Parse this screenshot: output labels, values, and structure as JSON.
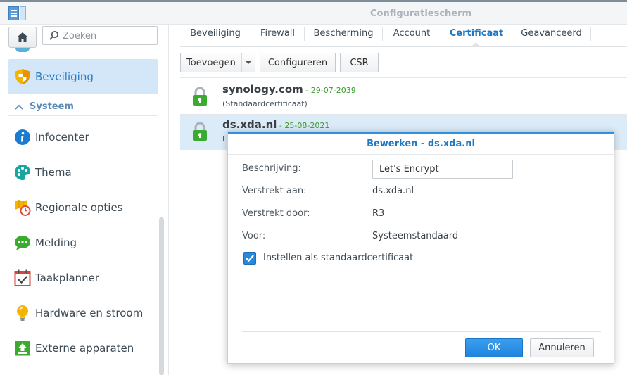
{
  "window": {
    "title": "Configuratiescherm",
    "app_icon": "control-panel-icon"
  },
  "sidebar": {
    "search": {
      "placeholder": "Zoeken",
      "value": ""
    },
    "home_icon": "home-icon",
    "active_item": {
      "label": "Beveiliging",
      "icon": "shield-icon"
    },
    "section": {
      "label": "Systeem",
      "collapse_icon": "chevron-up-icon"
    },
    "items": [
      {
        "label": "Infocenter",
        "icon": "info-icon"
      },
      {
        "label": "Thema",
        "icon": "palette-icon"
      },
      {
        "label": "Regionale opties",
        "icon": "map-clock-icon"
      },
      {
        "label": "Melding",
        "icon": "chat-bubble-icon"
      },
      {
        "label": "Taakplanner",
        "icon": "calendar-check-icon"
      },
      {
        "label": "Hardware en stroom",
        "icon": "lightbulb-icon"
      },
      {
        "label": "Externe apparaten",
        "icon": "upload-icon"
      }
    ]
  },
  "tabs": [
    {
      "label": "Beveiliging",
      "active": false
    },
    {
      "label": "Firewall",
      "active": false
    },
    {
      "label": "Bescherming",
      "active": false
    },
    {
      "label": "Account",
      "active": false
    },
    {
      "label": "Certificaat",
      "active": true
    },
    {
      "label": "Geavanceerd",
      "active": false
    }
  ],
  "toolbar": {
    "add_label": "Toevoegen",
    "configure_label": "Configureren",
    "csr_label": "CSR"
  },
  "certificates": [
    {
      "name": "synology.com",
      "separator": " - ",
      "date": "29-07-2039",
      "sub": "(Standaardcertificaat)",
      "icon": "lock-icon"
    },
    {
      "name": "ds.xda.nl",
      "separator": " - ",
      "date": "25-08-2021",
      "sub": "L",
      "icon": "lock-icon"
    }
  ],
  "dialog": {
    "title": "Bewerken - ds.xda.nl",
    "description_label": "Beschrijving:",
    "description_value": "Let's Encrypt",
    "issued_to_label": "Verstrekt aan:",
    "issued_to_value": "ds.xda.nl",
    "issued_by_label": "Verstrekt door:",
    "issued_by_value": "R3",
    "for_label": "Voor:",
    "for_value": "Systeemstandaard",
    "checkbox_label": "Instellen als standaardcertificaat",
    "checkbox_checked": true,
    "ok_label": "OK",
    "cancel_label": "Annuleren"
  },
  "colors": {
    "accent": "#1d79c4",
    "selected_bg": "#d3e7f8",
    "lock_green": "#3aab2e",
    "date_green": "#3a9a2c",
    "ok_button": "#2a8ae0"
  }
}
